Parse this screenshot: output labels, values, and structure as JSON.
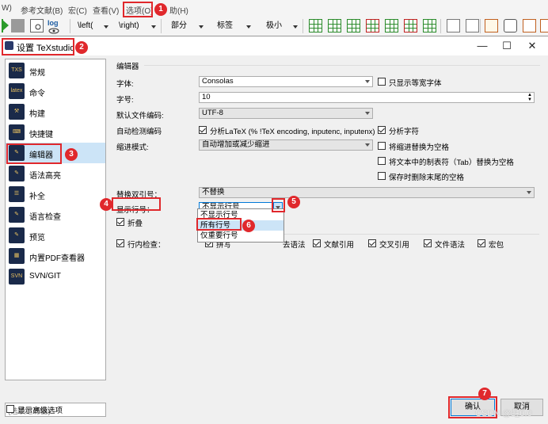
{
  "menubar": {
    "items": [
      "W)",
      "参考文献(B)",
      "宏(C)",
      "查看(V)",
      "选项(O)",
      "助(H)"
    ]
  },
  "toolbar": {
    "left_combo": "\\left(",
    "right_combo": "\\right)",
    "part_combo": "部分",
    "label_combo": "标签",
    "size_combo": "极小",
    "log_icon_label": "log"
  },
  "dialog": {
    "title": "设置 TeXstudio",
    "sidebar": [
      {
        "label": "常规",
        "icon": "TXS"
      },
      {
        "label": "命令",
        "icon": "latex"
      },
      {
        "label": "构建",
        "icon": "build"
      },
      {
        "label": "快捷键",
        "icon": "keys"
      },
      {
        "label": "编辑器",
        "icon": "pen"
      },
      {
        "label": "语法高亮",
        "icon": "syntax"
      },
      {
        "label": "补全",
        "icon": "complete"
      },
      {
        "label": "语言检查",
        "icon": "lang"
      },
      {
        "label": "预览",
        "icon": "preview"
      },
      {
        "label": "内置PDF查看器",
        "icon": "pdf"
      },
      {
        "label": "SVN/GIT",
        "icon": "SVN"
      }
    ],
    "selected_index": 4,
    "filter_placeholder": "(选项过滤器)",
    "advanced_label": "显示高级选项",
    "group_title": "编辑器",
    "font": {
      "label": "字体:",
      "value": "Consolas",
      "mono_label": "只显示等宽字体"
    },
    "size": {
      "label": "字号:",
      "value": "10"
    },
    "encoding": {
      "label": "默认文件编码:",
      "value": "UTF-8"
    },
    "autodetect": {
      "label": "自动检测编码",
      "option1": "分析LaTeX (% !TeX encoding, inputenc, inputenx)",
      "option2": "分析字符"
    },
    "indent": {
      "label": "缩进模式:",
      "value": "自动增加或减少缩进",
      "tabs_label": "将缩进替换为空格"
    },
    "tab_replace_label": "将文本中的制表符（Tab）替换为空格",
    "trailing_label": "保存时删除末尾的空格",
    "quotes": {
      "label": "替换双引号：",
      "value": "不替换"
    },
    "linenumbers": {
      "label": "显示行号：",
      "value": "不显示行号",
      "options": [
        "不显示行号",
        "所有行号",
        "仅重要行号"
      ],
      "highlighted": 1
    },
    "fold_label": "折叠",
    "inline": {
      "label": "行内检查：",
      "items": [
        "拼写",
        "语法",
        "文献引用",
        "交叉引用",
        "文件语法",
        "宏包"
      ],
      "visible_partial": "去语法"
    },
    "ok_label": "确认",
    "cancel_label": "取消"
  },
  "annotations": [
    "1",
    "2",
    "3",
    "4",
    "5",
    "6",
    "7"
  ],
  "watermark": "CSDN @蛀0.0",
  "colors": {
    "annotation": "#e0282c",
    "selection": "#cce4f7"
  }
}
